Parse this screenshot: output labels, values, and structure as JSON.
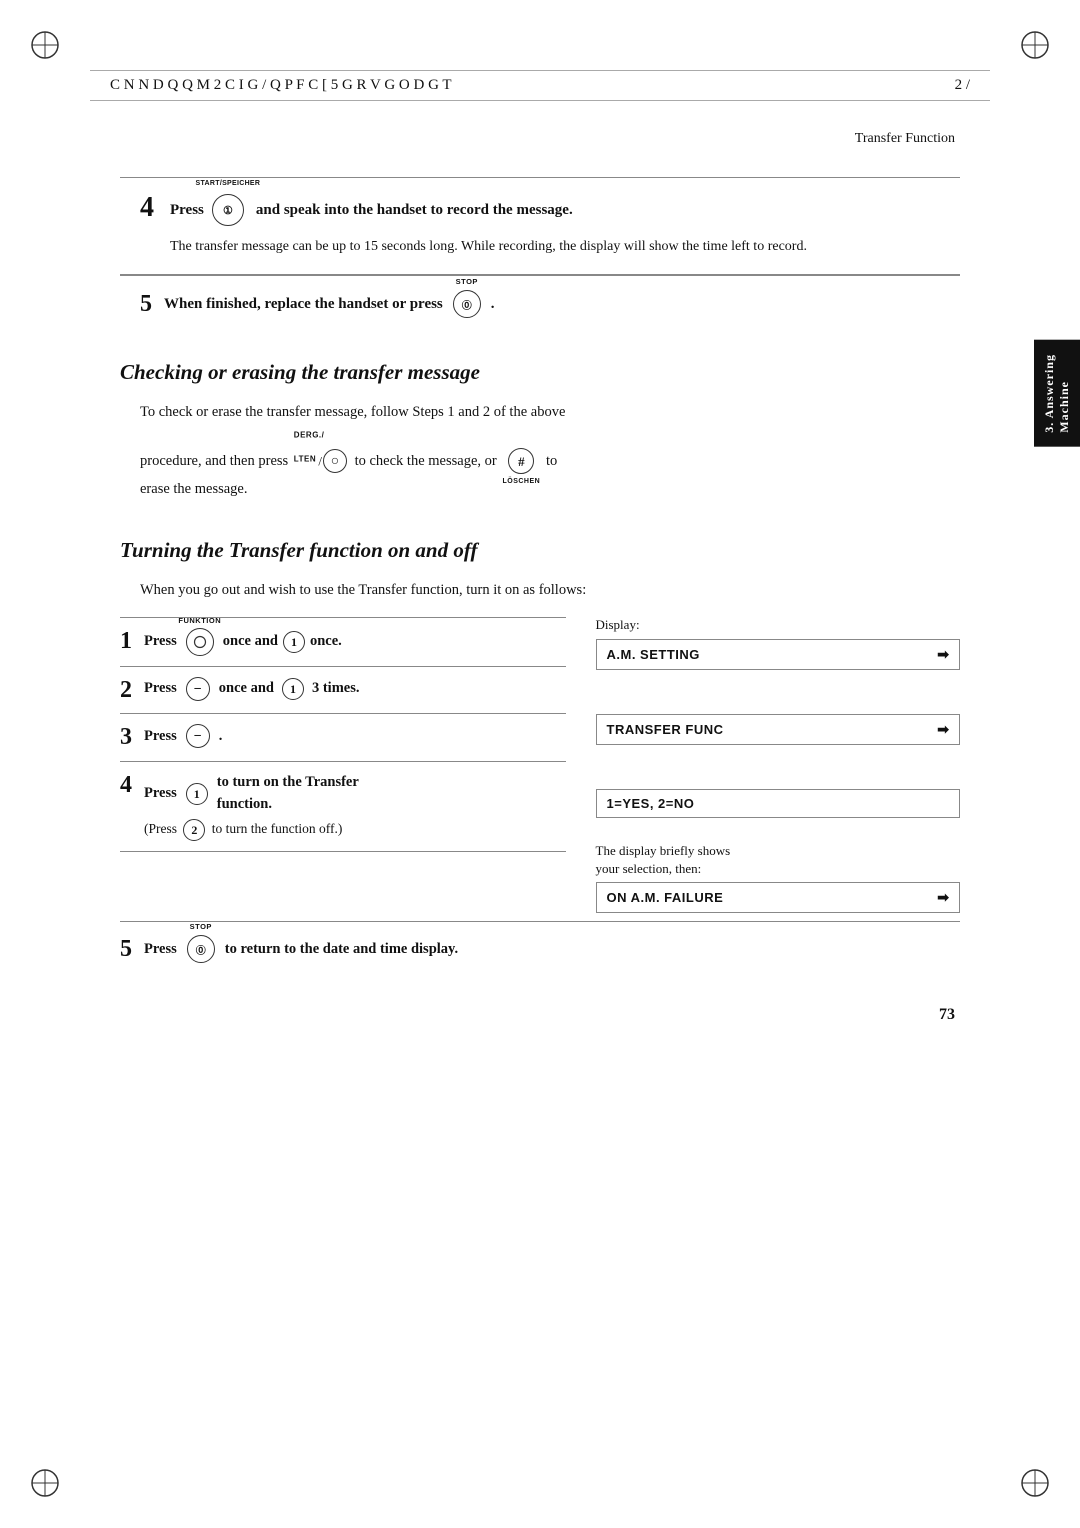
{
  "header": {
    "left_text": "C N N  D Q Q M   2 C I G   /  Q P F C [  5 G R V G O D G T",
    "right_text": "2 /"
  },
  "page_title": "Transfer Function",
  "step4_label": "START/SPEICHER",
  "step4_text": "Press",
  "step4_main": "and speak into the handset to record the message.",
  "step4_body": "The transfer message can be up to 15 seconds long. While recording, the display will show the time left to record.",
  "step5a_label": "STOP",
  "step5a_text": "When finished, replace the handset or press",
  "section1_heading": "Checking or erasing the transfer message",
  "section1_body1": "To check or erase the transfer message, follow Steps 1 and 2 of the above",
  "section1_body2": "procedure, and then press",
  "section1_derg": "DERG./",
  "section1_lten": "LTEN",
  "section1_body3": "to check the message, or",
  "section1_body4": "to",
  "section1_loschen": "LÖSCHEN",
  "section1_erase": "erase the message.",
  "section2_heading": "Turning the Transfer function on and off",
  "section2_intro": "When you go out and wish to use the Transfer function, turn it on as follows:",
  "display_label": "Display:",
  "steps": [
    {
      "num": "1",
      "text": "Press",
      "btn1_label": "FUNKTION",
      "btn1_content": "",
      "middle": "once and",
      "btn2_content": "1",
      "end": "once.",
      "display_text": "A.M. SETTING",
      "display_arrow": "➜"
    },
    {
      "num": "2",
      "text": "Press",
      "btn1_content": "−",
      "middle": "once and",
      "btn2_content": "1",
      "end": "3 times.",
      "display_text": "TRANSFER FUNC",
      "display_arrow": "➜"
    },
    {
      "num": "3",
      "text": "Press",
      "btn1_content": "−",
      "end": ".",
      "display_text": "1=YES, 2=NO",
      "display_arrow": ""
    },
    {
      "num": "4",
      "text": "Press",
      "btn1_content": "1",
      "main_text": "to turn on the Transfer function.",
      "sub_text": "(Press",
      "btn2_content": "2",
      "sub_end": "to turn the function off.)",
      "display_note": "The display briefly shows your selection, then:",
      "display_text": "ON A.M. FAILURE",
      "display_arrow": "➜"
    }
  ],
  "bottom_step5_text": "Press",
  "bottom_step5_label": "STOP",
  "bottom_step5_end": "to return to the date and time display.",
  "page_number": "73",
  "side_tab": "Answering Machine",
  "tab_line1": "Answering",
  "tab_line2": "Machine",
  "tab_num": "3. "
}
